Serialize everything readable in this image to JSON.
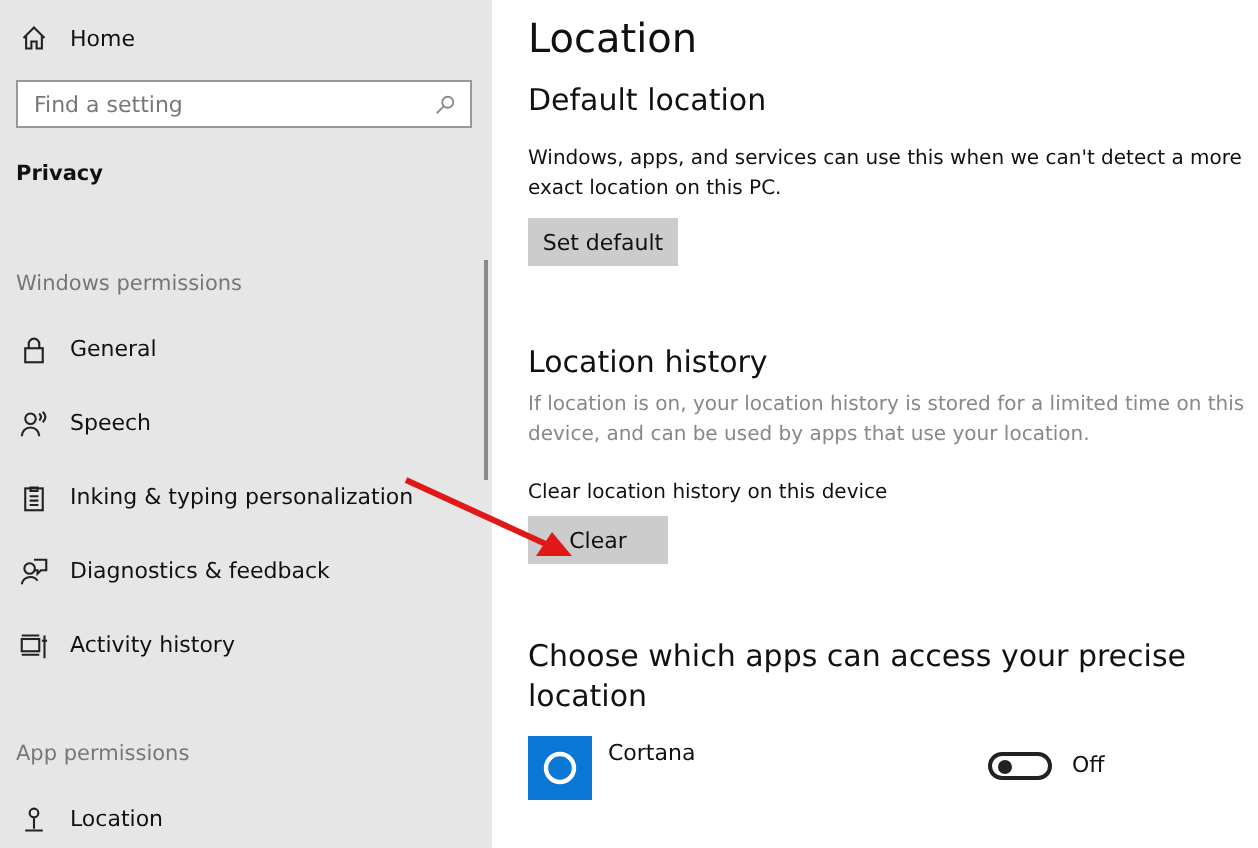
{
  "sidebar": {
    "home": "Home",
    "search": {
      "placeholder": "Find a setting"
    },
    "section_title": "Privacy",
    "groups": [
      {
        "title": "Windows permissions",
        "items": [
          {
            "label": "General",
            "kind": "lock"
          },
          {
            "label": "Speech",
            "kind": "speech"
          },
          {
            "label": "Inking & typing personalization",
            "kind": "clipboard"
          },
          {
            "label": "Diagnostics & feedback",
            "kind": "feedback"
          },
          {
            "label": "Activity history",
            "kind": "activity"
          }
        ]
      },
      {
        "title": "App permissions",
        "items": [
          {
            "label": "Location",
            "kind": "location"
          }
        ]
      }
    ]
  },
  "main": {
    "title": "Location",
    "default_location": {
      "heading": "Default location",
      "text": "Windows, apps, and services can use this when we can't detect a more exact location on this PC.",
      "button": "Set default"
    },
    "history": {
      "heading": "Location history",
      "text": "If location is on, your location history is stored for a limited time on this device, and can be used by apps that use your location.",
      "label": "Clear location history on this device",
      "button": "Clear"
    },
    "apps": {
      "heading": "Choose which apps can access your precise location",
      "items": [
        {
          "name": "Cortana",
          "on": false,
          "state": "Off"
        }
      ]
    }
  }
}
